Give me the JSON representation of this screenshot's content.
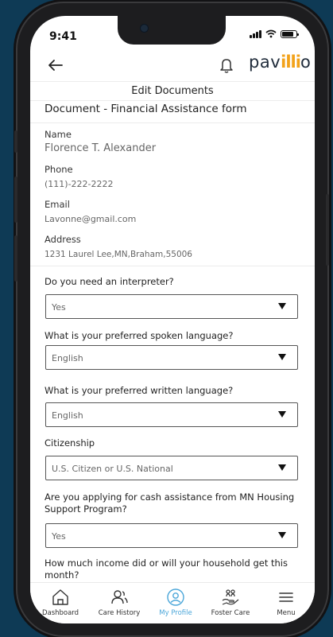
{
  "status_bar": {
    "time": "9:41"
  },
  "app": {
    "logo_prefix": "pav",
    "logo_mark": "illi",
    "logo_suffix": "o"
  },
  "page": {
    "header": "Edit Documents",
    "document_title": "Document - Financial Assistance form"
  },
  "profile": {
    "name_label": "Name",
    "name_value": "Florence T. Alexander",
    "phone_label": "Phone",
    "phone_value": "(111)-222-2222",
    "email_label": "Email",
    "email_value": "Lavonne@gmail.com",
    "address_label": "Address",
    "address_value": "1231 Laurel Lee,MN,Braham,55006"
  },
  "form": {
    "interpreter": {
      "question": "Do you need an interpreter?",
      "value": "Yes"
    },
    "spoken_language": {
      "question": "What is your preferred spoken language?",
      "value": "English"
    },
    "written_language": {
      "question": "What is your preferred written language?",
      "value": "English"
    },
    "citizenship": {
      "question": "Citizenship",
      "value": "U.S. Citizen or U.S. National"
    },
    "cash_assistance": {
      "question": "Are you applying for cash assistance from MN Housing Support Program?",
      "value": "Yes"
    },
    "income": {
      "question": "How much income did or will your household get this month?"
    }
  },
  "bottom_nav": {
    "items": [
      {
        "label": "Dashboard",
        "icon": "home-icon"
      },
      {
        "label": "Care History",
        "icon": "users-icon"
      },
      {
        "label": "My Profile",
        "icon": "profile-icon"
      },
      {
        "label": "Foster Care",
        "icon": "foster-care-icon"
      },
      {
        "label": "Menu",
        "icon": "menu-icon"
      }
    ],
    "active": "My Profile"
  },
  "colors": {
    "background": "#0e3a55",
    "accent": "#4aa6d9",
    "logo_mark": "#f2a21a",
    "text": "#222222"
  }
}
